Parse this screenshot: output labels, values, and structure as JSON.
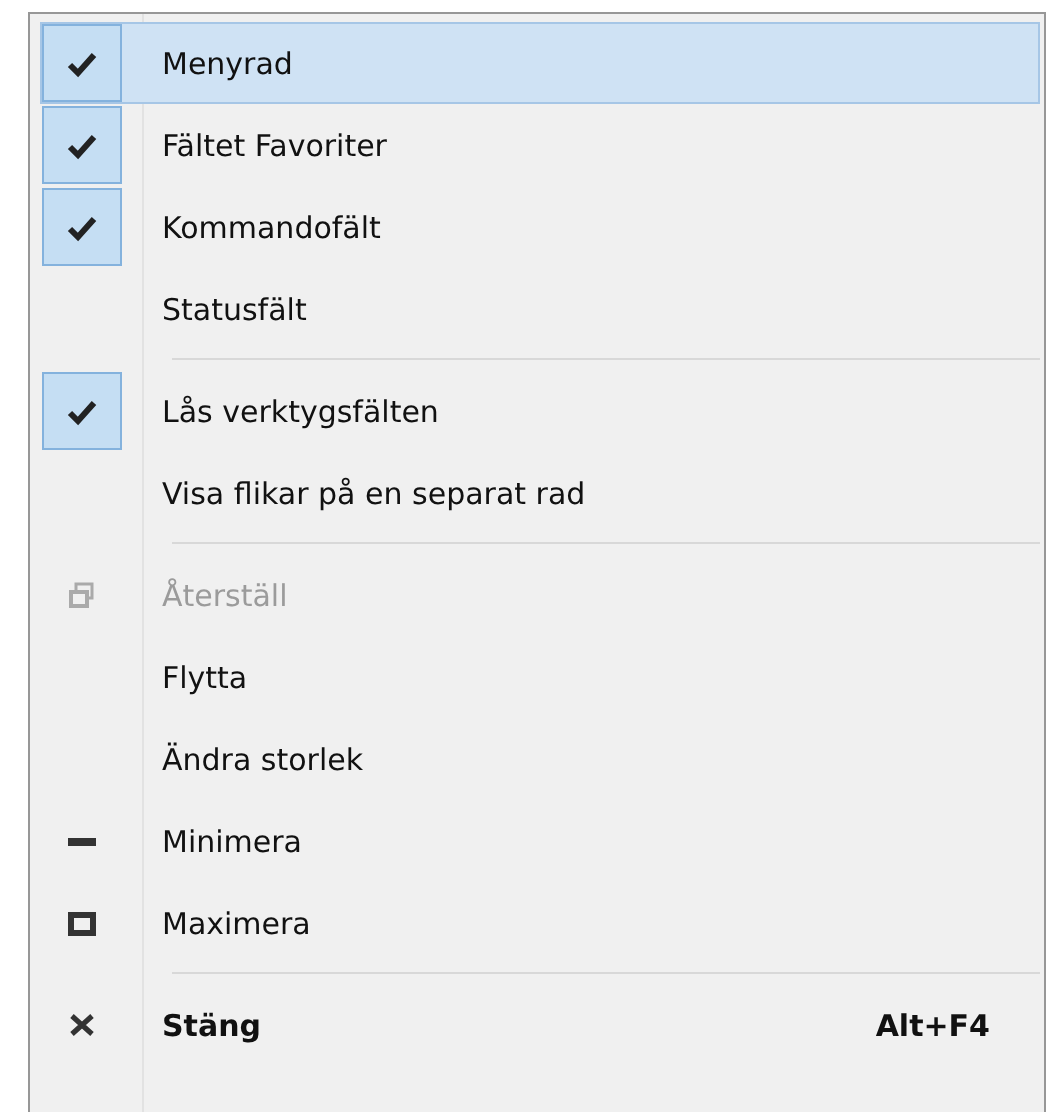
{
  "menu": {
    "groups": [
      {
        "items": [
          {
            "label": "Menyrad",
            "kind": "check",
            "checked": true,
            "selected": true
          },
          {
            "label": "Fältet Favoriter",
            "kind": "check",
            "checked": true,
            "selected": false
          },
          {
            "label": "Kommandofält",
            "kind": "check",
            "checked": true,
            "selected": false
          },
          {
            "label": "Statusfält",
            "kind": "check",
            "checked": false,
            "selected": false
          }
        ]
      },
      {
        "items": [
          {
            "label": "Lås verktygsfälten",
            "kind": "check",
            "checked": true,
            "selected": false
          },
          {
            "label": "Visa flikar på en separat rad",
            "kind": "check",
            "checked": false,
            "selected": false
          }
        ]
      },
      {
        "items": [
          {
            "label": "Återställ",
            "kind": "restore",
            "disabled": true,
            "default": false,
            "selected": false
          },
          {
            "label": "Flytta",
            "kind": "plain",
            "disabled": false,
            "default": false,
            "selected": false
          },
          {
            "label": "Ändra storlek",
            "kind": "plain",
            "disabled": false,
            "default": false,
            "selected": false
          },
          {
            "label": "Minimera",
            "kind": "minimize",
            "disabled": false,
            "default": false,
            "selected": false
          },
          {
            "label": "Maximera",
            "kind": "maximize",
            "disabled": false,
            "default": false,
            "selected": false
          }
        ]
      },
      {
        "items": [
          {
            "label": "Stäng",
            "kind": "close",
            "disabled": false,
            "default": true,
            "selected": false,
            "shortcut": "Alt+F4"
          }
        ]
      }
    ]
  }
}
